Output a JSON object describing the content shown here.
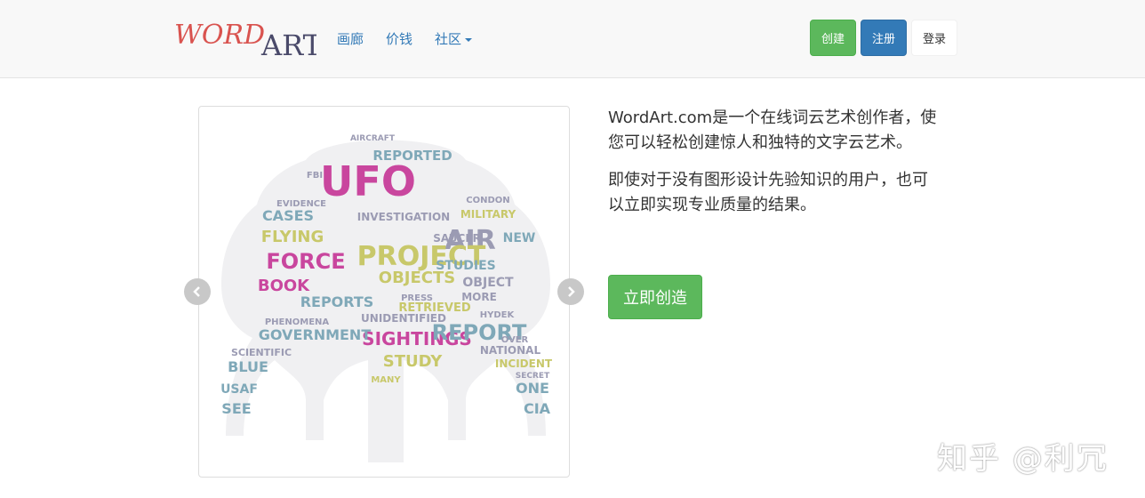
{
  "nav": {
    "logo_word": "WORD",
    "logo_art": "ART",
    "links": [
      "画廊",
      "价钱",
      "社区"
    ],
    "create": "创建",
    "register": "注册",
    "login": "登录"
  },
  "carousel": {
    "words": [
      {
        "text": "UFO",
        "color": "#c9469e"
      },
      {
        "text": "AIR",
        "color": "#9b9bb3"
      },
      {
        "text": "PROJECT",
        "color": "#c8c86a"
      },
      {
        "text": "FORCE",
        "color": "#c9469e"
      },
      {
        "text": "FLYING",
        "color": "#c8c86a"
      },
      {
        "text": "CASES",
        "color": "#7fa8b8"
      },
      {
        "text": "REPORTED",
        "color": "#7fa8b8"
      },
      {
        "text": "INVESTIGATION",
        "color": "#9b9bb3"
      },
      {
        "text": "SIGHTINGS",
        "color": "#c9469e"
      },
      {
        "text": "REPORT",
        "color": "#7fa8b8"
      },
      {
        "text": "GOVERNMENT",
        "color": "#7fa8b8"
      },
      {
        "text": "STUDY",
        "color": "#c8c86a"
      },
      {
        "text": "BOOK",
        "color": "#c9469e"
      },
      {
        "text": "OBJECTS",
        "color": "#c8c86a"
      },
      {
        "text": "REPORTS",
        "color": "#7fa8b8"
      },
      {
        "text": "STUDIES",
        "color": "#7fa8b8"
      },
      {
        "text": "OBJECT",
        "color": "#9b9bb3"
      },
      {
        "text": "RETRIEVED",
        "color": "#c8c86a"
      },
      {
        "text": "UNIDENTIFIED",
        "color": "#9b9bb3"
      },
      {
        "text": "MILITARY",
        "color": "#c8c86a"
      },
      {
        "text": "NEW",
        "color": "#7fa8b8"
      },
      {
        "text": "SAUCER",
        "color": "#9b9bb3"
      },
      {
        "text": "AIRCRAFT",
        "color": "#9b9bb3"
      },
      {
        "text": "BLUE",
        "color": "#7fa8b8"
      },
      {
        "text": "USAF",
        "color": "#7fa8b8"
      },
      {
        "text": "SEE",
        "color": "#7fa8b8"
      },
      {
        "text": "CIA",
        "color": "#7fa8b8"
      },
      {
        "text": "ONE",
        "color": "#7fa8b8"
      },
      {
        "text": "NATIONAL",
        "color": "#9b9bb3"
      },
      {
        "text": "INCIDENT",
        "color": "#c8c86a"
      },
      {
        "text": "SCIENTIFIC",
        "color": "#9b9bb3"
      },
      {
        "text": "MORE",
        "color": "#9b9bb3"
      },
      {
        "text": "CONDON",
        "color": "#9b9bb3"
      },
      {
        "text": "FBI",
        "color": "#9b9bb3"
      },
      {
        "text": "MANY",
        "color": "#c8c86a"
      },
      {
        "text": "HYDEK",
        "color": "#9b9bb3"
      },
      {
        "text": "PRESS",
        "color": "#9b9bb3"
      },
      {
        "text": "EVIDENCE",
        "color": "#9b9bb3"
      },
      {
        "text": "PHENOMENA",
        "color": "#9b9bb3"
      },
      {
        "text": "OVER",
        "color": "#9b9bb3"
      },
      {
        "text": "SECRET",
        "color": "#9b9bb3"
      }
    ]
  },
  "intro": {
    "p1": "WordArt.com是一个在线词云艺术创作者，使您可以轻松创建惊人和独特的文字云艺术。",
    "p2": "即使对于没有图形设计先验知识的用户，也可以立即实现专业质量的结果。",
    "start": "立即创造"
  },
  "watermark": "知乎 @利冗"
}
